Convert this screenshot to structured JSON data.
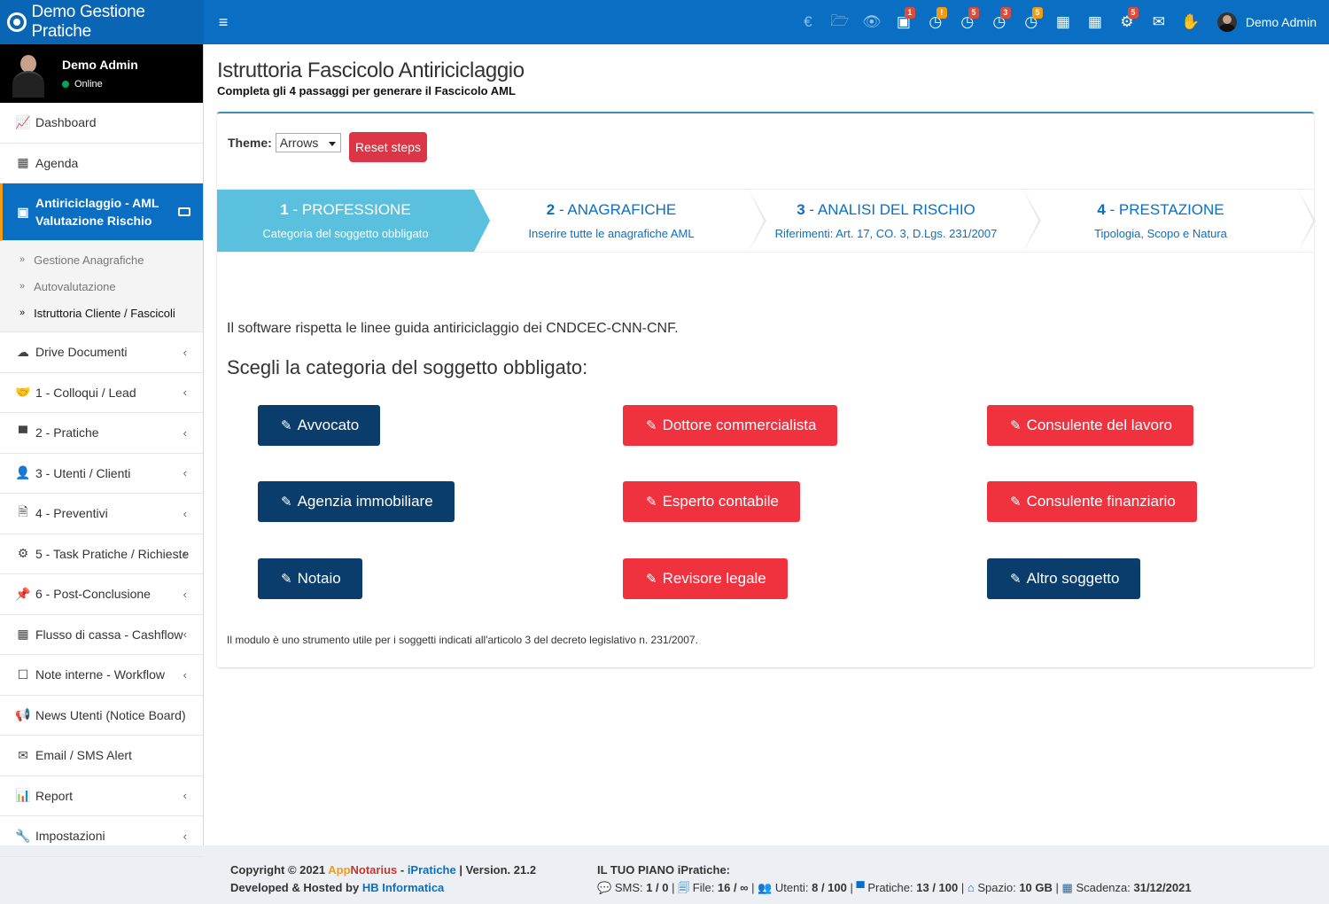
{
  "app": {
    "brand": "Demo Gestione Pratiche",
    "user_name": "Demo Admin"
  },
  "topbar": {
    "icons": [
      {
        "name": "euro-icon",
        "glyph": "€",
        "badge": "",
        "badge_color": ""
      },
      {
        "name": "folder-open-icon",
        "glyph": "🗁",
        "badge": "",
        "badge_color": ""
      },
      {
        "name": "eye-icon",
        "glyph": "👁",
        "badge": "",
        "badge_color": ""
      },
      {
        "name": "inbox-icon",
        "glyph": "▣",
        "badge": "1",
        "badge_color": "red"
      },
      {
        "name": "clock-icon-1",
        "glyph": "◷",
        "badge": "!",
        "badge_color": "orange"
      },
      {
        "name": "clock-icon-2",
        "glyph": "◷",
        "badge": "5",
        "badge_color": "red"
      },
      {
        "name": "clock-icon-3",
        "glyph": "◷",
        "badge": "3",
        "badge_color": "red"
      },
      {
        "name": "clock-icon-4",
        "glyph": "◷",
        "badge": "5",
        "badge_color": "orange"
      },
      {
        "name": "calendar-icon",
        "glyph": "▦",
        "badge": "",
        "badge_color": ""
      },
      {
        "name": "calendar-grid-icon",
        "glyph": "▦",
        "badge": "",
        "badge_color": ""
      },
      {
        "name": "gears-icon",
        "glyph": "⚙",
        "badge": "5",
        "badge_color": "red"
      },
      {
        "name": "envelope-icon",
        "glyph": "✉",
        "badge": "",
        "badge_color": ""
      },
      {
        "name": "hand-icon",
        "glyph": "✋",
        "badge": "",
        "badge_color": ""
      }
    ]
  },
  "sidebar": {
    "user_name": "Demo Admin",
    "status": "Online",
    "items": [
      {
        "label": "Dashboard",
        "icon": "line-chart-icon",
        "glyph": "📈"
      },
      {
        "label": "Agenda",
        "icon": "calendar-icon",
        "glyph": "▦"
      }
    ],
    "active": {
      "line1": "Antiriciclaggio - AML",
      "line2": "Valutazione Rischio"
    },
    "subitems": [
      "Gestione Anagrafiche",
      "Autovalutazione",
      "Istruttoria Cliente / Fascicoli"
    ],
    "items_after": [
      {
        "label": "Drive Documenti",
        "icon": "cloud-icon",
        "glyph": "☁",
        "chev": true
      },
      {
        "label": "1 - Colloqui / Lead",
        "icon": "handshake-icon",
        "glyph": "🤝",
        "chev": true
      },
      {
        "label": "2 - Pratiche",
        "icon": "archive-icon",
        "glyph": "▀",
        "chev": true
      },
      {
        "label": "3 - Utenti / Clienti",
        "icon": "user-icon",
        "glyph": "👤",
        "chev": true
      },
      {
        "label": "4 - Preventivi",
        "icon": "file-text-icon",
        "glyph": "🗎",
        "chev": true
      },
      {
        "label": "5 - Task Pratiche / Richieste",
        "icon": "gears-icon",
        "glyph": "⚙",
        "chev": true
      },
      {
        "label": "6 - Post-Conclusione",
        "icon": "thumbtack-icon",
        "glyph": "📌",
        "chev": true
      },
      {
        "label": "Flusso di cassa - Cashflow",
        "icon": "table-icon",
        "glyph": "▦",
        "chev": true
      },
      {
        "label": "Note interne - Workflow",
        "icon": "note-icon",
        "glyph": "☐",
        "chev": true
      },
      {
        "label": "News Utenti (Notice Board)",
        "icon": "bullhorn-icon",
        "glyph": "📢",
        "chev": false
      },
      {
        "label": "Email / SMS Alert",
        "icon": "envelope-icon",
        "glyph": "✉",
        "chev": false
      },
      {
        "label": "Report",
        "icon": "bar-chart-icon",
        "glyph": "📊",
        "chev": true
      },
      {
        "label": "Impostazioni",
        "icon": "wrench-icon",
        "glyph": "🔧",
        "chev": true
      }
    ]
  },
  "page": {
    "title": "Istruttoria Fascicolo Antiriciclaggio",
    "subtitle": "Completa gli 4 passaggi per generare il Fascicolo AML"
  },
  "wizard": {
    "theme_label": "Theme:",
    "theme_value": "Arrows",
    "reset_label": "Reset steps",
    "steps": [
      {
        "num": "1",
        "title": " - PROFESSIONE",
        "desc": "Categoria del soggetto obbligato"
      },
      {
        "num": "2",
        "title": " - ANAGRAFICHE",
        "desc": "Inserire tutte le anagrafiche AML"
      },
      {
        "num": "3",
        "title": " - ANALISI DEL RISCHIO",
        "desc": "Riferimenti: Art. 17, CO. 3, D.Lgs. 231/2007"
      },
      {
        "num": "4",
        "title": " - PRESTAZIONE",
        "desc": "Tipologia, Scopo e Natura"
      }
    ],
    "intro": "Il software rispetta le linee guida antiriciclaggio dei CNDCEC-CNN-CNF.",
    "question": "Scegli la categoria del soggetto obbligato:",
    "categories": [
      {
        "label": "Avvocato",
        "color": "navy"
      },
      {
        "label": "Dottore commercialista",
        "color": "red"
      },
      {
        "label": "Consulente del lavoro",
        "color": "red"
      },
      {
        "label": "Agenzia immobiliare",
        "color": "navy"
      },
      {
        "label": "Esperto contabile",
        "color": "red"
      },
      {
        "label": "Consulente finanziario",
        "color": "red"
      },
      {
        "label": "Notaio",
        "color": "navy"
      },
      {
        "label": "Revisore legale",
        "color": "red"
      },
      {
        "label": "Altro soggetto",
        "color": "navy"
      }
    ],
    "note": "Il modulo è uno strumento utile per i soggetti indicati all'articolo 3 del decreto legislativo n. 231/2007."
  },
  "footer": {
    "copyright": "Copyright © 2021 ",
    "app_a": "App",
    "app_b": "Notarius",
    "sep": " - ",
    "ipratiche": "iPratiche",
    "version": " | Version. 21.2",
    "developed": "Developed & Hosted by ",
    "company": "HB Informatica",
    "plan_title": "IL TUO PIANO iPratiche:",
    "sms_label": "SMS: ",
    "sms_value": "1 / 0",
    "file_label": "File: ",
    "file_value": "16 / ∞",
    "utenti_label": "Utenti: ",
    "utenti_value": "8 / 100",
    "pratiche_label": "Pratiche: ",
    "pratiche_value": "13 / 100",
    "spazio_label": "Spazio: ",
    "spazio_value": "10 GB",
    "scadenza_label": "Scadenza: ",
    "scadenza_value": "31/12/2021"
  },
  "colors": {
    "primary": "#0a6fc2",
    "step_active": "#5bc0de",
    "navy": "#0a3d6b",
    "red": "#f0323f",
    "reset": "#dc3545"
  }
}
